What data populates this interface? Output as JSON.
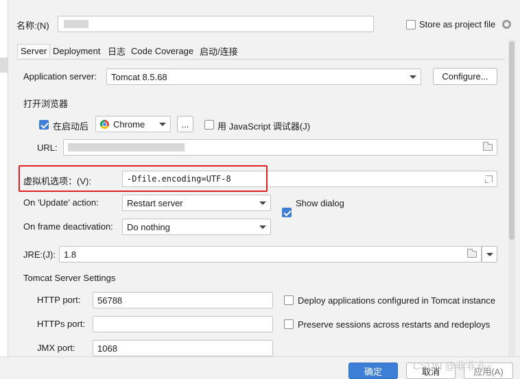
{
  "name_label": "名称:(N)",
  "name_value": "",
  "store_project_label": "Store as project file",
  "tabs": [
    "Server",
    "Deployment",
    "日志",
    "Code Coverage",
    "启动/连接"
  ],
  "app_server": {
    "label": "Application server:",
    "value": "Tomcat 8.5.68",
    "configure_label": "Configure..."
  },
  "browser": {
    "section_label": "打开浏览器",
    "after_launch_label": "在启动后",
    "after_launch_checked": true,
    "browser_value": "Chrome",
    "more_label": "...",
    "js_debugger_label": "用 JavaScript 调试器(J)",
    "js_debugger_checked": false,
    "url_label": "URL:"
  },
  "vm": {
    "label": "虚拟机选项：(V):",
    "value": "-Dfile.encoding=UTF-8"
  },
  "on_update": {
    "label": "On 'Update' action:",
    "value": "Restart server",
    "show_dialog_label": "Show dialog",
    "show_dialog_checked": true
  },
  "on_frame": {
    "label": "On frame deactivation:",
    "value": "Do nothing"
  },
  "jre": {
    "label": "JRE:(J):",
    "value": "1.8"
  },
  "tomcat": {
    "section_label": "Tomcat Server Settings",
    "http_label": "HTTP port:",
    "http_value": "56788",
    "https_label": "HTTPs port:",
    "https_value": "",
    "jmx_label": "JMX port:",
    "jmx_value": "1068",
    "deploy_label": "Deploy applications configured in Tomcat instance",
    "preserve_label": "Preserve sessions across restarts and redeploys"
  },
  "buttons": {
    "ok": "确定",
    "cancel": "取消",
    "apply": "应用(A)"
  },
  "watermark": "CSDN @非非非~",
  "colors": {
    "accent": "#3d7fd6",
    "highlight_box": "#e02020"
  }
}
